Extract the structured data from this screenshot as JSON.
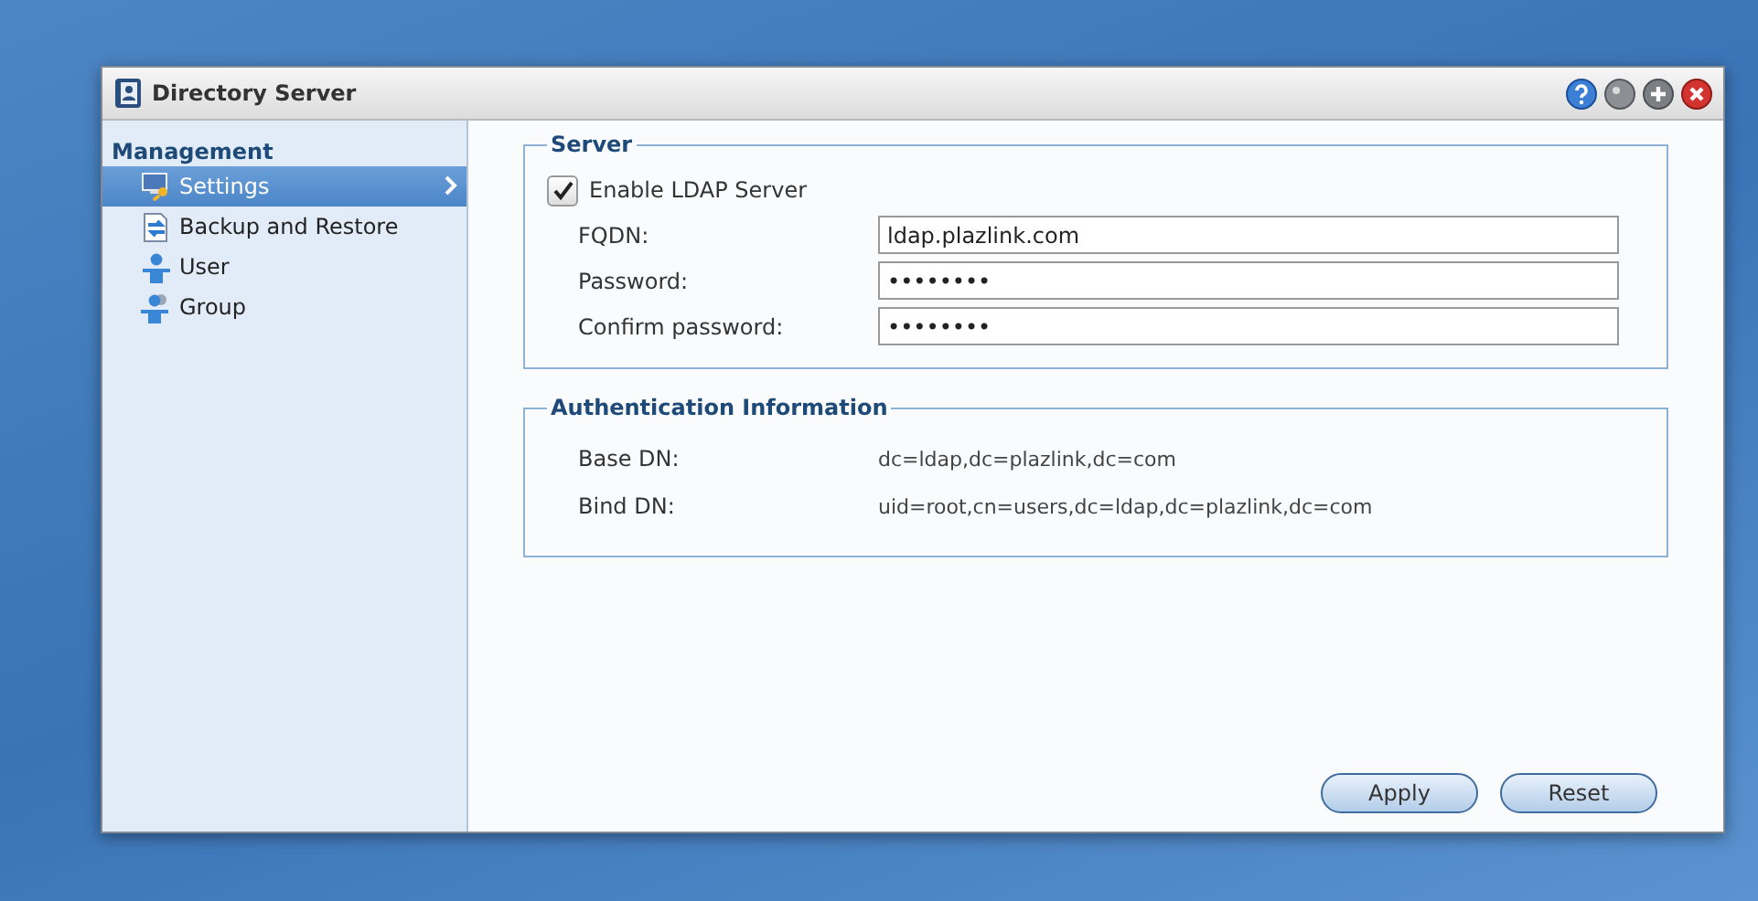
{
  "window": {
    "title": "Directory Server"
  },
  "sidebar": {
    "heading": "Management",
    "items": [
      {
        "label": "Settings",
        "kind": "settings",
        "selected": true
      },
      {
        "label": "Backup and Restore",
        "kind": "backup",
        "selected": false
      },
      {
        "label": "User",
        "kind": "user",
        "selected": false
      },
      {
        "label": "Group",
        "kind": "group",
        "selected": false
      }
    ]
  },
  "server": {
    "title": "Server",
    "enable": {
      "label": "Enable LDAP Server",
      "checked": true
    },
    "fields": [
      {
        "label": "FQDN:",
        "value": "ldap.plazlink.com"
      },
      {
        "label": "Password:",
        "value": "••••••••"
      },
      {
        "label": "Confirm password:",
        "value": "••••••••"
      }
    ]
  },
  "auth": {
    "title": "Authentication Information",
    "rows": [
      {
        "label": "Base DN:",
        "value": "dc=ldap,dc=plazlink,dc=com"
      },
      {
        "label": "Bind DN:",
        "value": "uid=root,cn=users,dc=ldap,dc=plazlink,dc=com"
      }
    ]
  },
  "buttons": [
    "Apply",
    "Reset"
  ]
}
